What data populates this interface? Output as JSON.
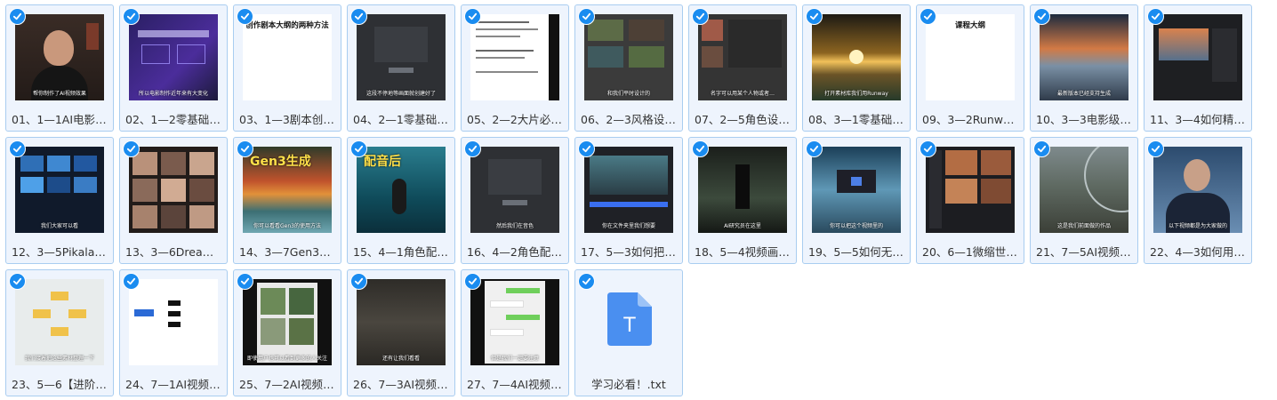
{
  "items": [
    {
      "label": "01、1—1AI电影一…",
      "caption": "帮你制作了AI视频效果",
      "title": "",
      "theme": "t-person"
    },
    {
      "label": "02、1—2零基础，…",
      "caption": "所以电影制作近年来有大变化",
      "title": "",
      "theme": "t-purple"
    },
    {
      "label": "03、1—3剧本创作…",
      "caption": "",
      "title": "创作剧本大纲的两种方法",
      "theme": "t-white"
    },
    {
      "label": "04、2—1零基础，…",
      "caption": "这段不停地等画面就创建好了",
      "title": "",
      "theme": "t-darkui"
    },
    {
      "label": "05、2—2大片必备…",
      "caption": "",
      "title": "",
      "theme": "t-doc"
    },
    {
      "label": "06、2—3风格设计…",
      "caption": "和我们平时设计的",
      "title": "",
      "theme": "t-grid"
    },
    {
      "label": "07、2—5角色设计…",
      "caption": "名字可以用某个人物或者…",
      "title": "",
      "theme": "t-grid2"
    },
    {
      "label": "08、3—1零基础，…",
      "caption": "打开素材库我们用Runway",
      "title": "",
      "theme": "t-sunset"
    },
    {
      "label": "09、3—2Runway…",
      "caption": "",
      "title": "课程大纲",
      "theme": "t-white"
    },
    {
      "label": "10、3—3电影级视…",
      "caption": "最新版本已经支持生成",
      "title": "",
      "theme": "t-clouds"
    },
    {
      "label": "11、3—4如何精准…",
      "caption": "",
      "title": "",
      "theme": "t-editor"
    },
    {
      "label": "12、3—5Pikalabs…",
      "caption": "我们大家可以看",
      "title": "",
      "theme": "t-blue"
    },
    {
      "label": "13、3—6Dreamin…",
      "caption": "",
      "title": "",
      "theme": "t-faces"
    },
    {
      "label": "14、3—7Gen3的…",
      "caption": "你可以看看Gen3的使用方法",
      "title": "Gen3生成",
      "theme": "t-autumn"
    },
    {
      "label": "15、4—1角色配音…",
      "caption": "",
      "title": "配音后",
      "theme": "t-water"
    },
    {
      "label": "16、4—2角色配音…",
      "caption": "然后我们在音色",
      "title": "",
      "theme": "t-darkui"
    },
    {
      "label": "17、5—3如何把影…",
      "caption": "你在文件夹里我们想要",
      "title": "",
      "theme": "t-editor2"
    },
    {
      "label": "18、5—4视频画质…",
      "caption": "AI研究员在这里",
      "title": "",
      "theme": "t-dim"
    },
    {
      "label": "19、5—5如何无痕…",
      "caption": "你可以把这个视频里的",
      "title": "",
      "theme": "t-lake"
    },
    {
      "label": "20、6—1微缩世界…",
      "caption": "",
      "title": "",
      "theme": "t-mini"
    },
    {
      "label": "21、7—5AI视频定…",
      "caption": "这是我们前面做的作品",
      "title": "",
      "theme": "t-scifi"
    },
    {
      "label": "22、4—3如何用G…",
      "caption": "以下视频都是为大家做的",
      "title": "",
      "theme": "t-suit"
    },
    {
      "label": "23、5—6【进阶】…",
      "caption": "我们接着把这些素材整理一下",
      "title": "",
      "theme": "t-flow"
    },
    {
      "label": "24、7—1AI视频商…",
      "caption": "",
      "title": "",
      "theme": "t-mind"
    },
    {
      "label": "25、7—2AI视频如…",
      "caption": "即使用户也可以看到更多的人关注",
      "title": "",
      "theme": "t-phone"
    },
    {
      "label": "26、7—3AI视频如…",
      "caption": "还有让我们看看",
      "title": "",
      "theme": "t-rock"
    },
    {
      "label": "27、7—4AI视频的…",
      "caption": "但是我们一定要注意",
      "title": "",
      "theme": "t-chat"
    },
    {
      "label": "学习必看！.txt",
      "caption": "",
      "title": "",
      "theme": "t-file",
      "icon_letter": "T",
      "icon_name": "text-file-icon"
    }
  ],
  "colors": {
    "accent": "#1a8cf0",
    "tile_bg": "#eef4fd",
    "tile_border": "#a9cdf0"
  }
}
